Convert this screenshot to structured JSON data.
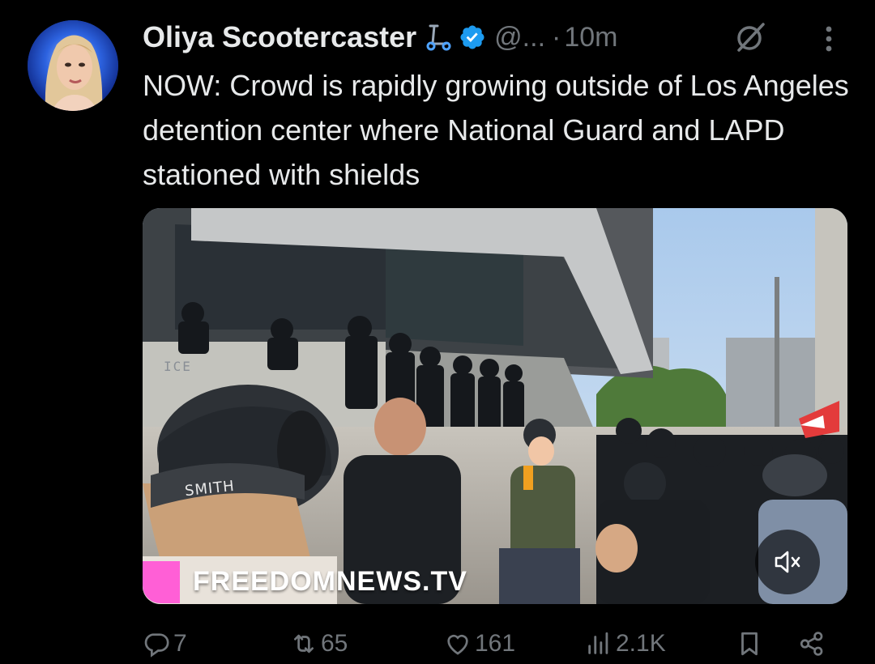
{
  "post": {
    "author_name": "Oliya Scootercaster",
    "handle": "@...",
    "separator": "·",
    "time": "10m",
    "text": "NOW: Crowd is rapidly growing outside of Los Angeles detention center where National Guard and LAPD stationed with shields"
  },
  "media": {
    "watermark": "FREEDOMNEWS.TV",
    "cap_label": "SMITH",
    "wall_text": "ICE",
    "muted": true
  },
  "actions": {
    "replies": "7",
    "reposts": "65",
    "likes": "161",
    "views": "2.1K"
  },
  "icons": {
    "name_emoji": "scooter-icon",
    "verified": "verified-badge-icon",
    "grok": "grok-icon",
    "more": "more-icon",
    "reply": "reply-icon",
    "repost": "repost-icon",
    "like": "heart-icon",
    "views": "views-icon",
    "bookmark": "bookmark-icon",
    "share": "share-icon",
    "mute": "volume-muted-icon"
  },
  "colors": {
    "background": "#000000",
    "text": "#e7e9ea",
    "secondary": "#71767b",
    "verified": "#1d9bf0"
  }
}
